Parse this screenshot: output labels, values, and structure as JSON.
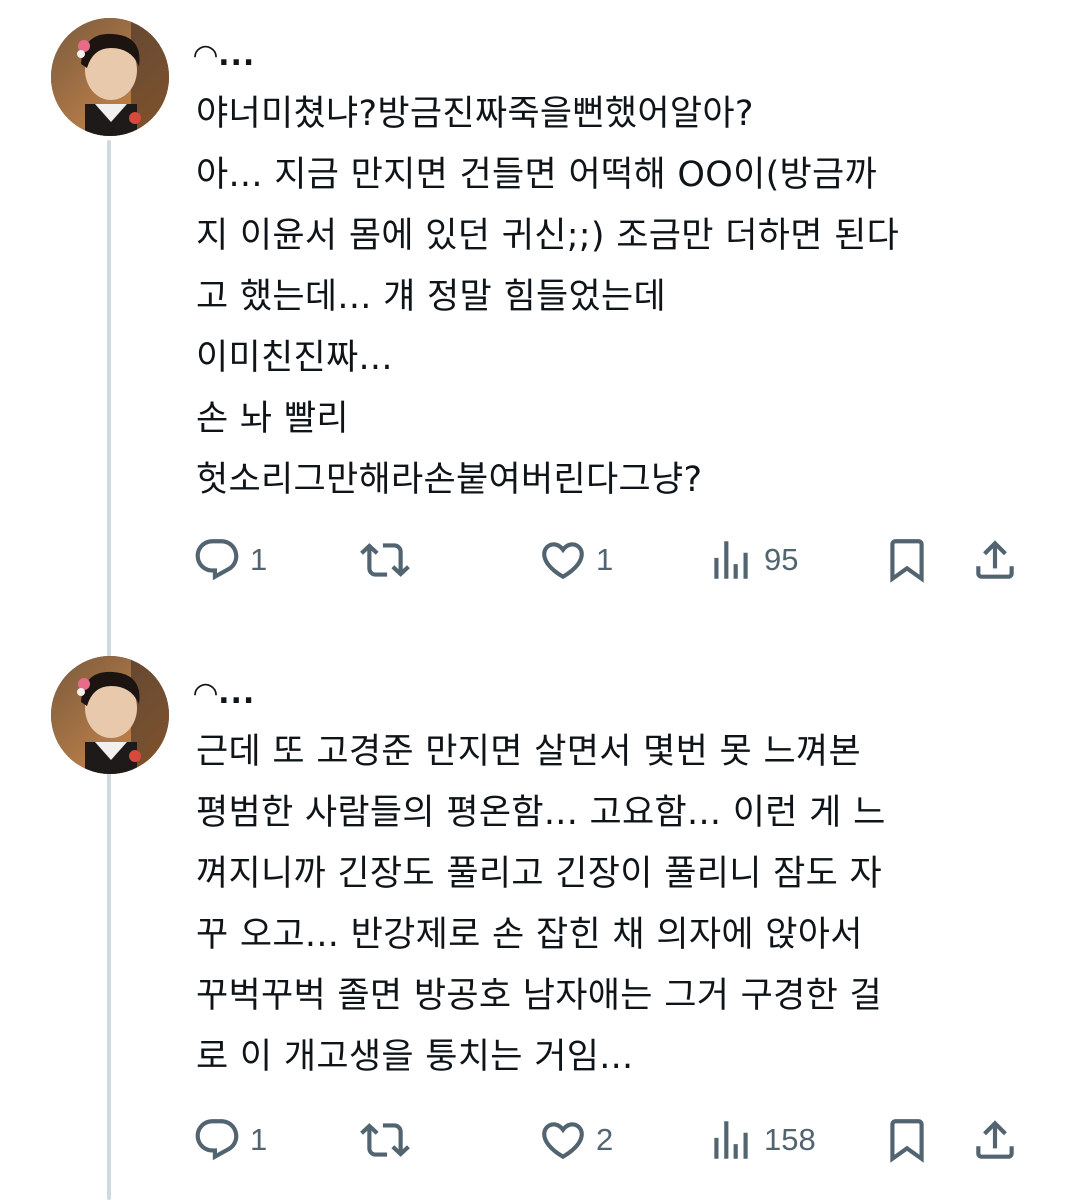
{
  "tweets": [
    {
      "name": "◠...",
      "body": "야너미쳤냐?방금진짜죽을뻔했어알아?\n아... 지금 만지면 건들면 어떡해 OO이(방금까\n지 이윤서 몸에 있던 귀신;;) 조금만 더하면 된다\n고 했는데... 걔 정말 힘들었는데\n이미친진짜...\n손 놔 빨리\n헛소리그만해라손붙여버린다그냥?",
      "reply_count": "1",
      "retweet_count": "",
      "like_count": "1",
      "view_count": "95",
      "icons": {
        "reply": "reply-icon",
        "retweet": "retweet-icon",
        "like": "heart-icon",
        "views": "views-icon",
        "bookmark": "bookmark-icon",
        "share": "share-icon"
      }
    },
    {
      "name": "◠...",
      "body": "근데 또 고경준 만지면 살면서 몇번 못 느껴본\n평범한 사람들의 평온함... 고요함... 이런 게 느\n껴지니까 긴장도 풀리고 긴장이 풀리니 잠도 자\n꾸 오고... 반강제로 손 잡힌 채 의자에 앉아서\n꾸벅꾸벅 졸면 방공호 남자애는 그거 구경한 걸\n로 이 개고생을 퉁치는 거임...",
      "reply_count": "1",
      "retweet_count": "",
      "like_count": "2",
      "view_count": "158",
      "icons": {
        "reply": "reply-icon",
        "retweet": "retweet-icon",
        "like": "heart-icon",
        "views": "views-icon",
        "bookmark": "bookmark-icon",
        "share": "share-icon"
      }
    }
  ],
  "colors": {
    "text": "#0f1419",
    "secondary": "#536471",
    "thread_line": "#cfd9de",
    "background": "#ffffff"
  }
}
